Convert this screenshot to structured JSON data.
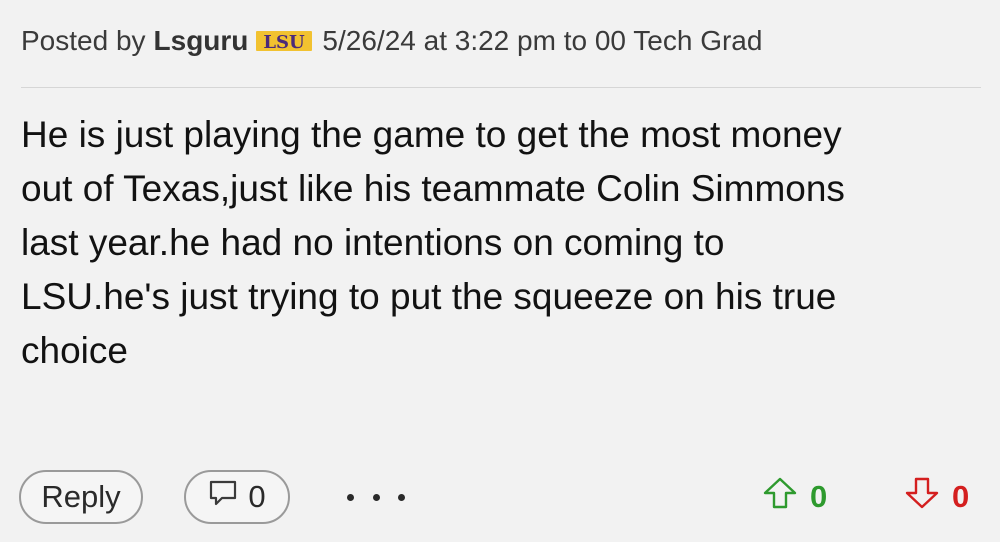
{
  "post": {
    "posted_by_label": "Posted by",
    "author": "Lsguru",
    "team_logo_text": "LSU",
    "timestamp": "5/26/24 at 3:22 pm",
    "to_label": "to",
    "reply_to_user": "00 Tech Grad",
    "body_lines": [
      "He is just playing the game to get the most money",
      "out of Texas,just like his teammate Colin Simmons",
      "last year.he had no intentions on coming to",
      "LSU.he's just trying to put the squeeze on his true",
      "choice"
    ]
  },
  "actions": {
    "reply_label": "Reply",
    "comment_count": "0",
    "upvote_count": "0",
    "downvote_count": "0"
  },
  "colors": {
    "upvote": "#2e9a2e",
    "downvote": "#d41f1f",
    "logo_purple": "#4b2a7a",
    "logo_gold": "#f2c230"
  },
  "icons": {
    "team_logo": "lsu-logo",
    "comment": "speech-bubble-icon",
    "more": "ellipsis-icon",
    "upvote": "arrow-up-icon",
    "downvote": "arrow-down-icon"
  }
}
